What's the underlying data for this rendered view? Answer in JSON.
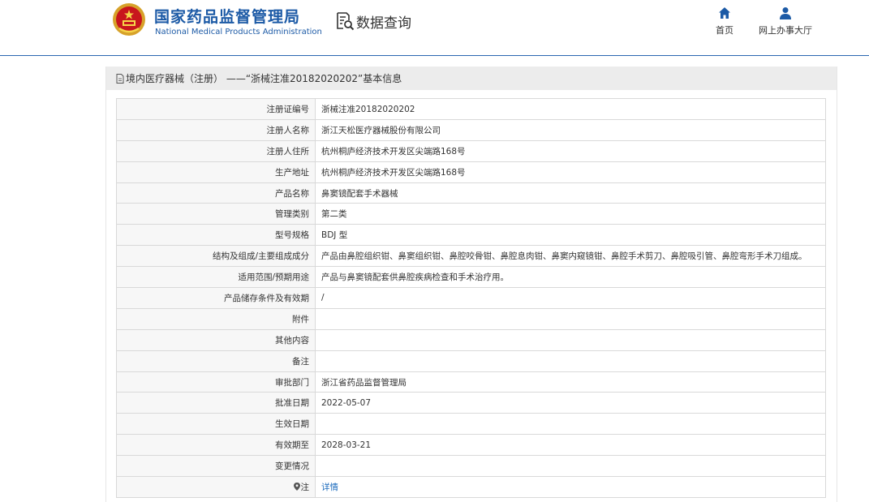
{
  "header": {
    "brand_cn": "国家药品监督管理局",
    "brand_en": "National Medical Products Administration",
    "query_label": "数据查询",
    "home_label": "首页",
    "hall_label": "网上办事大厅"
  },
  "panel": {
    "title": "境内医疗器械（注册） ——“浙械注准20182020202”基本信息"
  },
  "rows": [
    {
      "label": "注册证编号",
      "value": "浙械注准20182020202"
    },
    {
      "label": "注册人名称",
      "value": "浙江天松医疗器械股份有限公司"
    },
    {
      "label": "注册人住所",
      "value": "杭州桐庐经济技术开发区尖端路168号"
    },
    {
      "label": "生产地址",
      "value": "杭州桐庐经济技术开发区尖端路168号"
    },
    {
      "label": "产品名称",
      "value": "鼻窦镜配套手术器械"
    },
    {
      "label": "管理类别",
      "value": "第二类"
    },
    {
      "label": "型号规格",
      "value": "BDJ 型"
    },
    {
      "label": "结构及组成/主要组成成分",
      "value": "产品由鼻腔组织钳、鼻窦组织钳、鼻腔咬骨钳、鼻腔息肉钳、鼻窦内窥镜钳、鼻腔手术剪刀、鼻腔吸引管、鼻腔弯形手术刀组成。"
    },
    {
      "label": "适用范围/预期用途",
      "value": "产品与鼻窦镜配套供鼻腔疾病检查和手术治疗用。"
    },
    {
      "label": "产品储存条件及有效期",
      "value": "/"
    },
    {
      "label": "附件",
      "value": ""
    },
    {
      "label": "其他内容",
      "value": ""
    },
    {
      "label": "备注",
      "value": ""
    },
    {
      "label": "审批部门",
      "value": "浙江省药品监督管理局"
    },
    {
      "label": "批准日期",
      "value": "2022-05-07"
    },
    {
      "label": "生效日期",
      "value": ""
    },
    {
      "label": "有效期至",
      "value": "2028-03-21"
    },
    {
      "label": "变更情况",
      "value": ""
    },
    {
      "label": "注",
      "value": "详情"
    }
  ],
  "colors": {
    "brand_blue": "#1c5aa6",
    "link_blue": "#1c6bbd",
    "label_bg": "#f7f7f7",
    "border": "#d9d9d9"
  }
}
